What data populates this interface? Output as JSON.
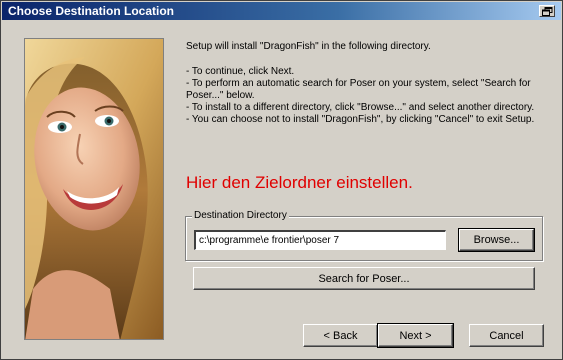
{
  "window": {
    "title": "Choose Destination Location"
  },
  "content": {
    "intro": "Setup will install \"DragonFish\" in the following directory.",
    "bullets": [
      "- To continue, click Next.",
      "- To perform an automatic search for Poser on your system, select \"Search for Poser...\" below.",
      "- To install to a different directory, click \"Browse...\" and select another directory.",
      "- You can choose not to install \"DragonFish\", by clicking \"Cancel\" to exit Setup."
    ],
    "annotation": "Hier den Zielordner einstellen."
  },
  "destination": {
    "group_label": "Destination Directory",
    "path_value": "c:\\programme\\e frontier\\poser 7",
    "browse_label": "Browse..."
  },
  "search_label": "Search for Poser...",
  "buttons": {
    "back": "< Back",
    "next": "Next >",
    "cancel": "Cancel"
  },
  "colors": {
    "annotation": "#e00000",
    "titlebar": "#0a246a"
  },
  "icons": {
    "titlebar_button": "restore-icon"
  }
}
